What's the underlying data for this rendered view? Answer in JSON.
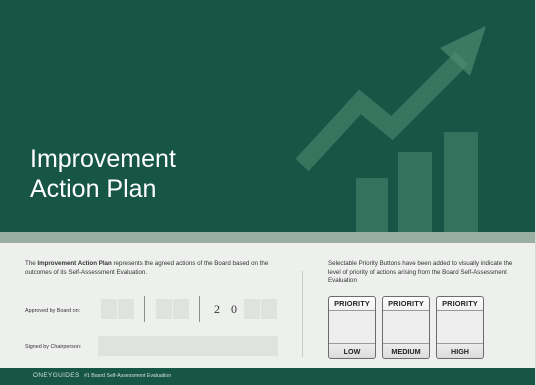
{
  "hero": {
    "title_line1": "Improvement",
    "title_line2": "Action Plan"
  },
  "intro": {
    "prefix": "The ",
    "bold": "Improvement Action Plan",
    "rest": " represents the agreed actions of the Board based on the outcomes of its Self-Assessment Evaluation."
  },
  "fields": {
    "approved_label": "Approved by Board on:",
    "year_digit1": "2",
    "year_digit2": "0",
    "signed_label": "Signed by Chairperson:"
  },
  "priority_note": "Selectable Priority Buttons have been added to visually indicate the level of priority of actions arising from the Board Self-Assessment Evaluation",
  "priority_buttons": [
    {
      "top": "PRIORITY",
      "bottom": "LOW"
    },
    {
      "top": "PRIORITY",
      "bottom": "MEDIUM"
    },
    {
      "top": "PRIORITY",
      "bottom": "HIGH"
    }
  ],
  "footer": {
    "brand": "ONEYGUIDES",
    "doc": "#1 Board Self-Assessment Evaluation"
  },
  "colors": {
    "brand_green": "#175644",
    "band_grey": "#9aaea2",
    "body_bg": "#eef0ee"
  }
}
